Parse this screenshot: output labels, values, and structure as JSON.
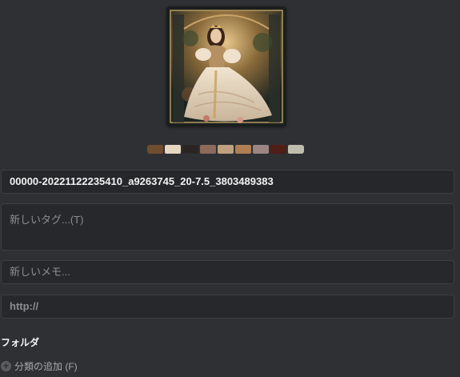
{
  "image": {
    "alt_icon": "artwork-thumbnail"
  },
  "palette": [
    "#6f4d2d",
    "#e5d7c1",
    "#2a2522",
    "#8d6a5a",
    "#c0a07f",
    "#b17f54",
    "#9d8582",
    "#4e1e17",
    "#bfbeae"
  ],
  "fields": {
    "name_value": "00000-20221122235410_a9263745_20-7.5_3803489383",
    "tags_placeholder": "新しいタグ...(T)",
    "memo_placeholder": "新しいメモ...",
    "url_placeholder": "http://"
  },
  "folder": {
    "title": "フォルダ",
    "add_label": "分類の追加 (F)"
  }
}
